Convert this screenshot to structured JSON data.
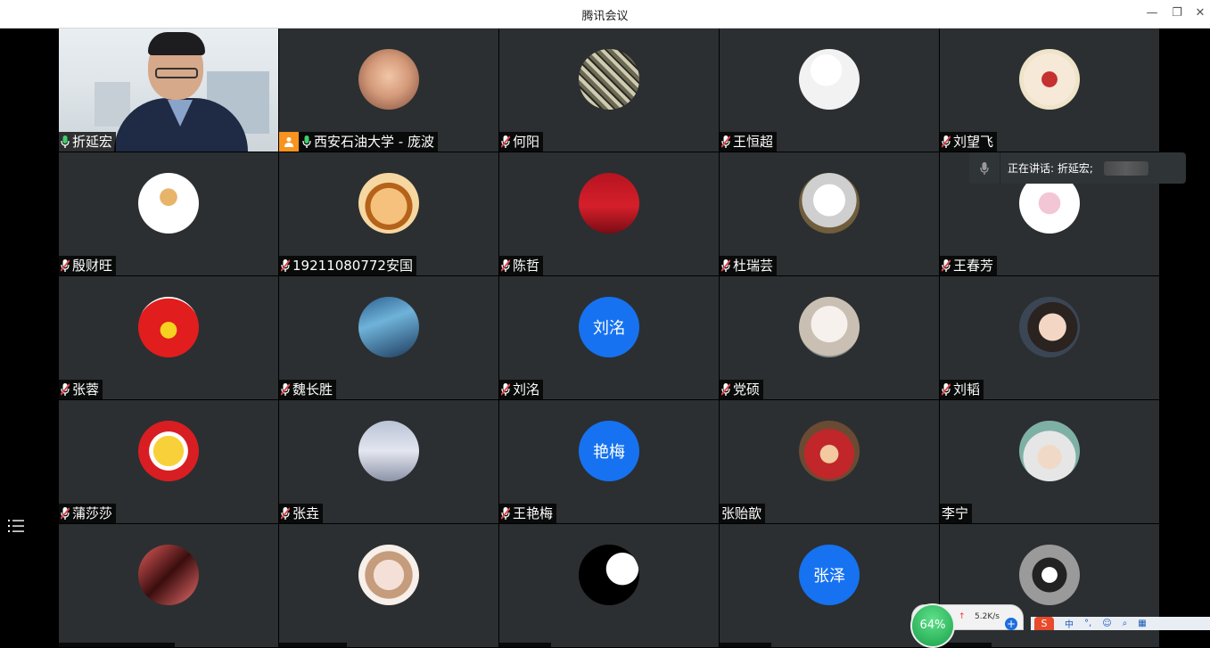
{
  "window": {
    "title": "腾讯会议",
    "minimize": "—",
    "restore": "❐",
    "close": "✕"
  },
  "speaking_indicator": {
    "text": "正在讲话: 折延宏;"
  },
  "participants": [
    {
      "name": "折延宏",
      "video": true,
      "mic": "on",
      "avatar": "video"
    },
    {
      "name": "西安石油大学 - 庞波",
      "host": true,
      "mic": "on",
      "avatar": "baby-photo"
    },
    {
      "name": "何阳",
      "mic": "muted",
      "avatar": "cube-photo"
    },
    {
      "name": "王恒超",
      "mic": "muted",
      "avatar": "sketch-figure"
    },
    {
      "name": "刘望飞",
      "mic": "muted",
      "avatar": "anime-figure"
    },
    {
      "name": "殷财旺",
      "mic": "muted",
      "avatar": "cartoon-kid"
    },
    {
      "name": "19211080772安国",
      "mic": "muted",
      "avatar": "cartoon-boy"
    },
    {
      "name": "陈哲",
      "mic": "muted",
      "avatar": "football-player"
    },
    {
      "name": "杜瑞芸",
      "mic": "muted",
      "avatar": "white-cat"
    },
    {
      "name": "王春芳",
      "mic": "muted",
      "avatar": "pink-cartoon"
    },
    {
      "name": "张蓉",
      "mic": "muted",
      "avatar": "red-hair-cartoon"
    },
    {
      "name": "魏长胜",
      "mic": "muted",
      "avatar": "blue-landscape"
    },
    {
      "name": "刘洺",
      "mic": "muted",
      "avatar_text": "刘洺"
    },
    {
      "name": "党硕",
      "mic": "muted",
      "avatar": "fluffy-cat"
    },
    {
      "name": "刘韬",
      "mic": "muted",
      "avatar": "boy-photo"
    },
    {
      "name": "蒲莎莎",
      "mic": "muted",
      "avatar": "yellow-duck"
    },
    {
      "name": "张垚",
      "mic": "muted",
      "avatar": "anime-man"
    },
    {
      "name": "王艳梅",
      "mic": "muted",
      "avatar_text": "艳梅"
    },
    {
      "name": "张贻歆",
      "mic": "none",
      "avatar": "teletubby"
    },
    {
      "name": "李宁",
      "mic": "none",
      "avatar": "anime-silver-hair"
    },
    {
      "name": "",
      "mic": "none",
      "avatar": "red-anime"
    },
    {
      "name": "",
      "mic": "none",
      "avatar": "girl-photo"
    },
    {
      "name": "",
      "mic": "none",
      "avatar": "moon-silhouette"
    },
    {
      "name": "",
      "mic": "none",
      "avatar_text": "张泽"
    },
    {
      "name": "",
      "mic": "none",
      "avatar": "football-badge"
    }
  ],
  "net_widget": {
    "percent": "64%",
    "speed": "5.2K/s"
  },
  "tray": {
    "ime": "S",
    "lang": "中"
  },
  "colors": {
    "tile_bg": "#2b2f31",
    "text_avatar": "#1672f0",
    "muted_mic": "#e0464b",
    "active_mic": "#3fcf6b",
    "host_badge": "#f7931e"
  }
}
